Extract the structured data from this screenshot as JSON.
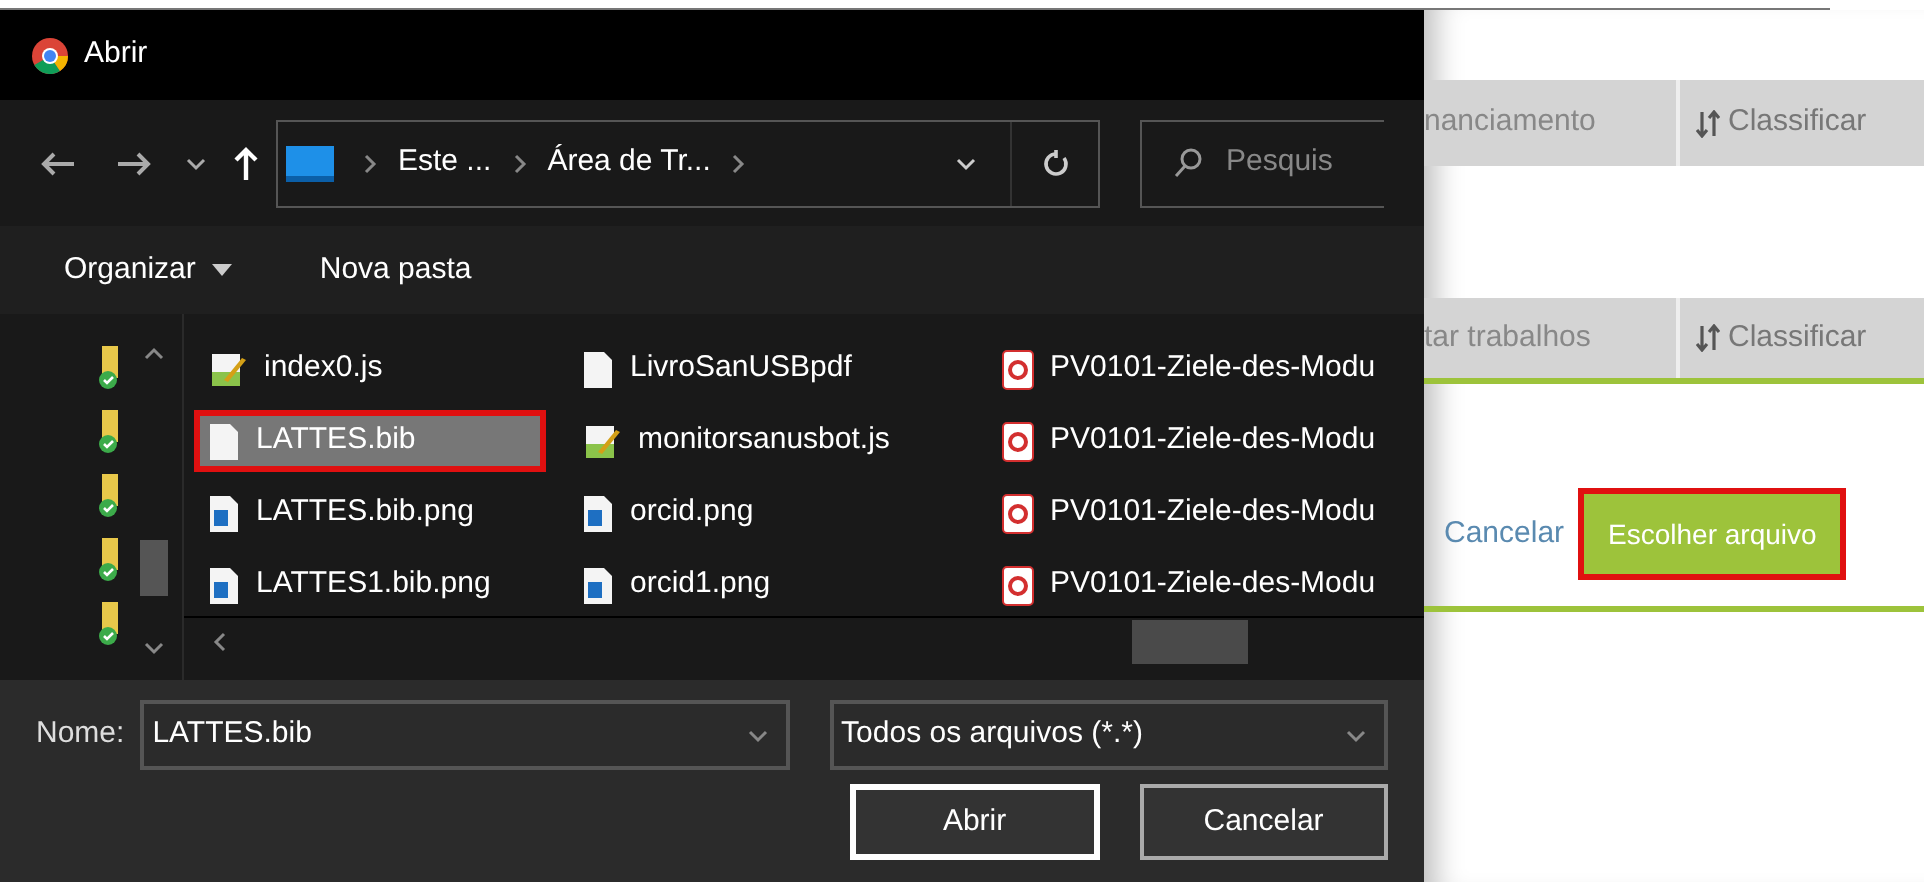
{
  "dialog": {
    "title": "Abrir",
    "breadcrumb": [
      "Este ...",
      "Área de Tr..."
    ],
    "search": {
      "placeholder": "Pesquis"
    },
    "toolbar": [
      {
        "label": "Organizar",
        "kind": "menu"
      },
      {
        "label": "Nova pasta",
        "kind": "button"
      }
    ],
    "files": [
      {
        "name": "index0.js",
        "kind": "script",
        "selected": false,
        "annotated": false
      },
      {
        "name": "LivroSanUSBpdf",
        "kind": "blank",
        "selected": false,
        "annotated": false
      },
      {
        "name": "PV0101-Ziele-des-Modu",
        "kind": "pdf",
        "selected": false,
        "annotated": false
      },
      {
        "name": "LATTES.bib",
        "kind": "blank",
        "selected": true,
        "annotated": true
      },
      {
        "name": "monitorsanusbot.js",
        "kind": "script",
        "selected": false,
        "annotated": false
      },
      {
        "name": "PV0101-Ziele-des-Modu",
        "kind": "pdf",
        "selected": false,
        "annotated": false
      },
      {
        "name": "LATTES.bib.png",
        "kind": "image",
        "selected": false,
        "annotated": false
      },
      {
        "name": "orcid.png",
        "kind": "image",
        "selected": false,
        "annotated": false
      },
      {
        "name": "PV0101-Ziele-des-Modu",
        "kind": "pdf",
        "selected": false,
        "annotated": false
      },
      {
        "name": "LATTES1.bib.png",
        "kind": "image",
        "selected": false,
        "annotated": false
      },
      {
        "name": "orcid1.png",
        "kind": "image",
        "selected": false,
        "annotated": false
      },
      {
        "name": "PV0101-Ziele-des-Modu",
        "kind": "pdf",
        "selected": false,
        "annotated": false
      }
    ],
    "filename": {
      "label": "Nome:",
      "value": "LATTES.bib"
    },
    "filetype": "Todos os arquivos (*.*)",
    "buttons": [
      {
        "label": "Abrir",
        "default": true
      },
      {
        "label": "Cancelar",
        "default": false
      }
    ]
  },
  "page": {
    "rows": [
      {
        "cells": [
          "nanciamento",
          "Classificar"
        ],
        "underlined": false
      },
      {
        "cells": [
          "tar trabalhos",
          "Classificar"
        ],
        "underlined": true
      }
    ],
    "cancel": "Cancelar",
    "choose": {
      "label": "Escolher arquivo",
      "annotated": true
    }
  }
}
